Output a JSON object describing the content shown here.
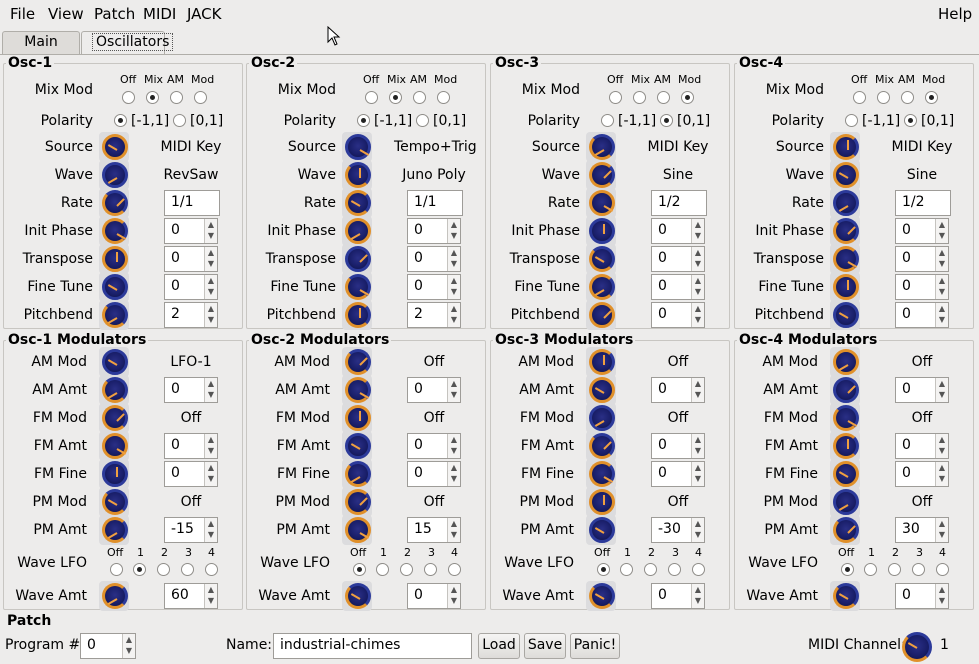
{
  "menu": {
    "file": "File",
    "view": "View",
    "patch": "Patch",
    "midi": "MIDI",
    "jack": "JACK",
    "help": "Help"
  },
  "tabs": {
    "main": "Main",
    "oscillators": "Oscillators"
  },
  "osc_labels": {
    "mix_mod": "Mix Mod",
    "polarity": "Polarity",
    "source": "Source",
    "wave": "Wave",
    "rate": "Rate",
    "init_phase": "Init Phase",
    "transpose": "Transpose",
    "fine_tune": "Fine Tune",
    "pitchbend": "Pitchbend",
    "mix_off": "Off",
    "mix_mix": "Mix",
    "mix_am": "AM",
    "mix_modw": "Mod",
    "pol_bipolar": "[-1,1]",
    "pol_unipolar": "[0,1]"
  },
  "mod_labels": {
    "am_mod": "AM Mod",
    "am_amt": "AM Amt",
    "fm_mod": "FM Mod",
    "fm_amt": "FM Amt",
    "fm_fine": "FM Fine",
    "pm_mod": "PM Mod",
    "pm_amt": "PM Amt",
    "wave_lfo": "Wave LFO",
    "wave_amt": "Wave Amt",
    "lfo_off": "Off",
    "lfo_1": "1",
    "lfo_2": "2",
    "lfo_3": "3",
    "lfo_4": "4"
  },
  "oscillators": [
    {
      "title": "Osc-1",
      "mix_mod": 1,
      "polarity": 0,
      "source": "MIDI Key",
      "wave": "RevSaw",
      "rate": "1/1",
      "init_phase": "0",
      "transpose": "0",
      "fine_tune": "0",
      "pitchbend": "2"
    },
    {
      "title": "Osc-2",
      "mix_mod": 1,
      "polarity": 0,
      "source": "Tempo+Trig",
      "wave": "Juno Poly",
      "rate": "1/1",
      "init_phase": "0",
      "transpose": "0",
      "fine_tune": "0",
      "pitchbend": "2"
    },
    {
      "title": "Osc-3",
      "mix_mod": 3,
      "polarity": 1,
      "source": "MIDI Key",
      "wave": "Sine",
      "rate": "1/2",
      "init_phase": "0",
      "transpose": "0",
      "fine_tune": "0",
      "pitchbend": "0"
    },
    {
      "title": "Osc-4",
      "mix_mod": 3,
      "polarity": 1,
      "source": "MIDI Key",
      "wave": "Sine",
      "rate": "1/2",
      "init_phase": "0",
      "transpose": "0",
      "fine_tune": "0",
      "pitchbend": "0"
    }
  ],
  "modulators": [
    {
      "title": "Osc-1 Modulators",
      "am_mod": "LFO-1",
      "am_amt": "0",
      "fm_mod": "Off",
      "fm_amt": "0",
      "fm_fine": "0",
      "pm_mod": "Off",
      "pm_amt": "-15",
      "wave_lfo": 1,
      "wave_amt": "60"
    },
    {
      "title": "Osc-2 Modulators",
      "am_mod": "Off",
      "am_amt": "0",
      "fm_mod": "Off",
      "fm_amt": "0",
      "fm_fine": "0",
      "pm_mod": "Off",
      "pm_amt": "15",
      "wave_lfo": 0,
      "wave_amt": "0"
    },
    {
      "title": "Osc-3 Modulators",
      "am_mod": "Off",
      "am_amt": "0",
      "fm_mod": "Off",
      "fm_amt": "0",
      "fm_fine": "0",
      "pm_mod": "Off",
      "pm_amt": "-30",
      "wave_lfo": 0,
      "wave_amt": "0"
    },
    {
      "title": "Osc-4 Modulators",
      "am_mod": "Off",
      "am_amt": "0",
      "fm_mod": "Off",
      "fm_amt": "0",
      "fm_fine": "0",
      "pm_mod": "Off",
      "pm_amt": "30",
      "wave_lfo": 0,
      "wave_amt": "0"
    }
  ],
  "patch": {
    "title": "Patch",
    "program_label": "Program #:",
    "program_value": "0",
    "name_label": "Name:",
    "name_value": "industrial-chimes",
    "load": "Load",
    "save": "Save",
    "panic": "Panic!",
    "midi_channel_label": "MIDI Channel:",
    "midi_channel_value": "1"
  },
  "colors": {
    "knob_accent": "#e0902a",
    "knob_body": "#1a1f6a",
    "background": "#edeceb"
  }
}
